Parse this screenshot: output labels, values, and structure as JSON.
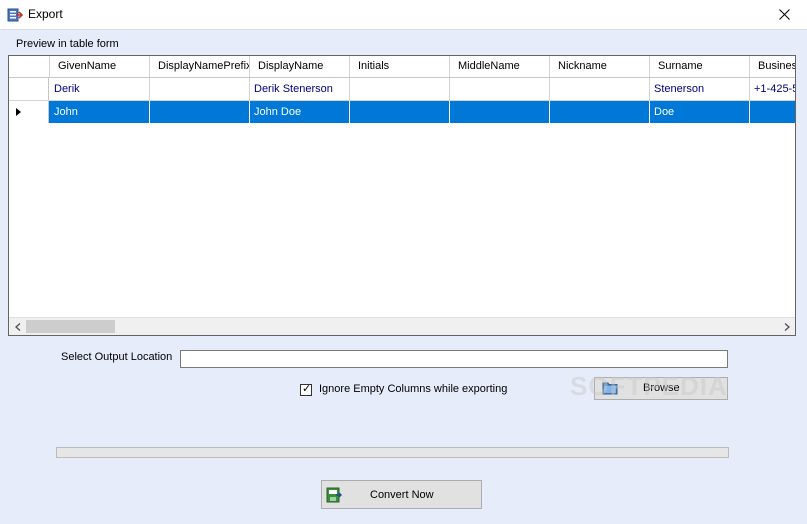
{
  "window": {
    "title": "Export"
  },
  "preview": {
    "label": "Preview in table form"
  },
  "grid": {
    "columns": [
      "GivenName",
      "DisplayNamePrefix",
      "DisplayName",
      "Initials",
      "MiddleName",
      "Nickname",
      "Surname",
      "Business"
    ],
    "rows": [
      [
        "Derik",
        "",
        "Derik Stenerson",
        "",
        "",
        "",
        "Stenerson",
        "+1-425-5"
      ],
      [
        "John",
        "",
        "John Doe",
        "",
        "",
        "",
        "Doe",
        ""
      ]
    ],
    "selected_row": 1
  },
  "output": {
    "label": "Select Output Location",
    "value": ""
  },
  "options": {
    "ignore_empty_label": "Ignore Empty Columns while exporting",
    "ignore_empty_checked": true,
    "check_glyph": "✓"
  },
  "buttons": {
    "browse_label": "Browse",
    "convert_label": "Convert Now"
  },
  "progress": {
    "value": 0
  },
  "watermark": {
    "text": "SOFTPEDIA"
  },
  "icons": {
    "app": "export-app-icon",
    "close": "close-icon",
    "browse": "folder-icon",
    "convert": "convert-icon",
    "row_selector": "row-selector-arrow-icon"
  },
  "colors": {
    "selection": "#0078d7",
    "client_bg": "#e6ecf9",
    "cell_text": "#000080"
  }
}
